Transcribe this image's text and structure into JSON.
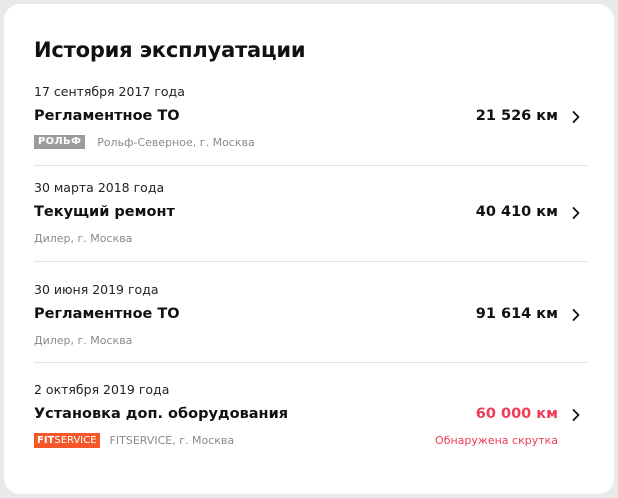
{
  "card": {
    "title": "История эксплуатации"
  },
  "entries": [
    {
      "date": "17 сентября 2017 года",
      "service": "Регламентное ТО",
      "km": "21 526 км",
      "logo": "РОЛЬФ",
      "place": "Рольф-Северное, г. Москва"
    },
    {
      "date": "30 марта 2018 года",
      "service": "Текущий ремонт",
      "km": "40 410 км",
      "place": "Дилер, г. Москва"
    },
    {
      "date": "30 июня 2019 года",
      "service": "Регламентное ТО",
      "km": "91 614 км",
      "place": "Дилер, г. Москва"
    },
    {
      "date": "2 октября 2019 года",
      "service": "Установка доп. оборудования",
      "km": "60 000 км",
      "logo_part1": "FIT",
      "logo_part2": "SERVICE",
      "place": "FITSERVICE, г. Москва",
      "warning": "Обнаружена скрутка"
    }
  ],
  "colors": {
    "alert": "#ef3b55",
    "fitservice_brand": "#f4572a",
    "rolf_logo": "#9c9c9c"
  },
  "icons": {
    "row_action": "chevron-right-icon"
  }
}
